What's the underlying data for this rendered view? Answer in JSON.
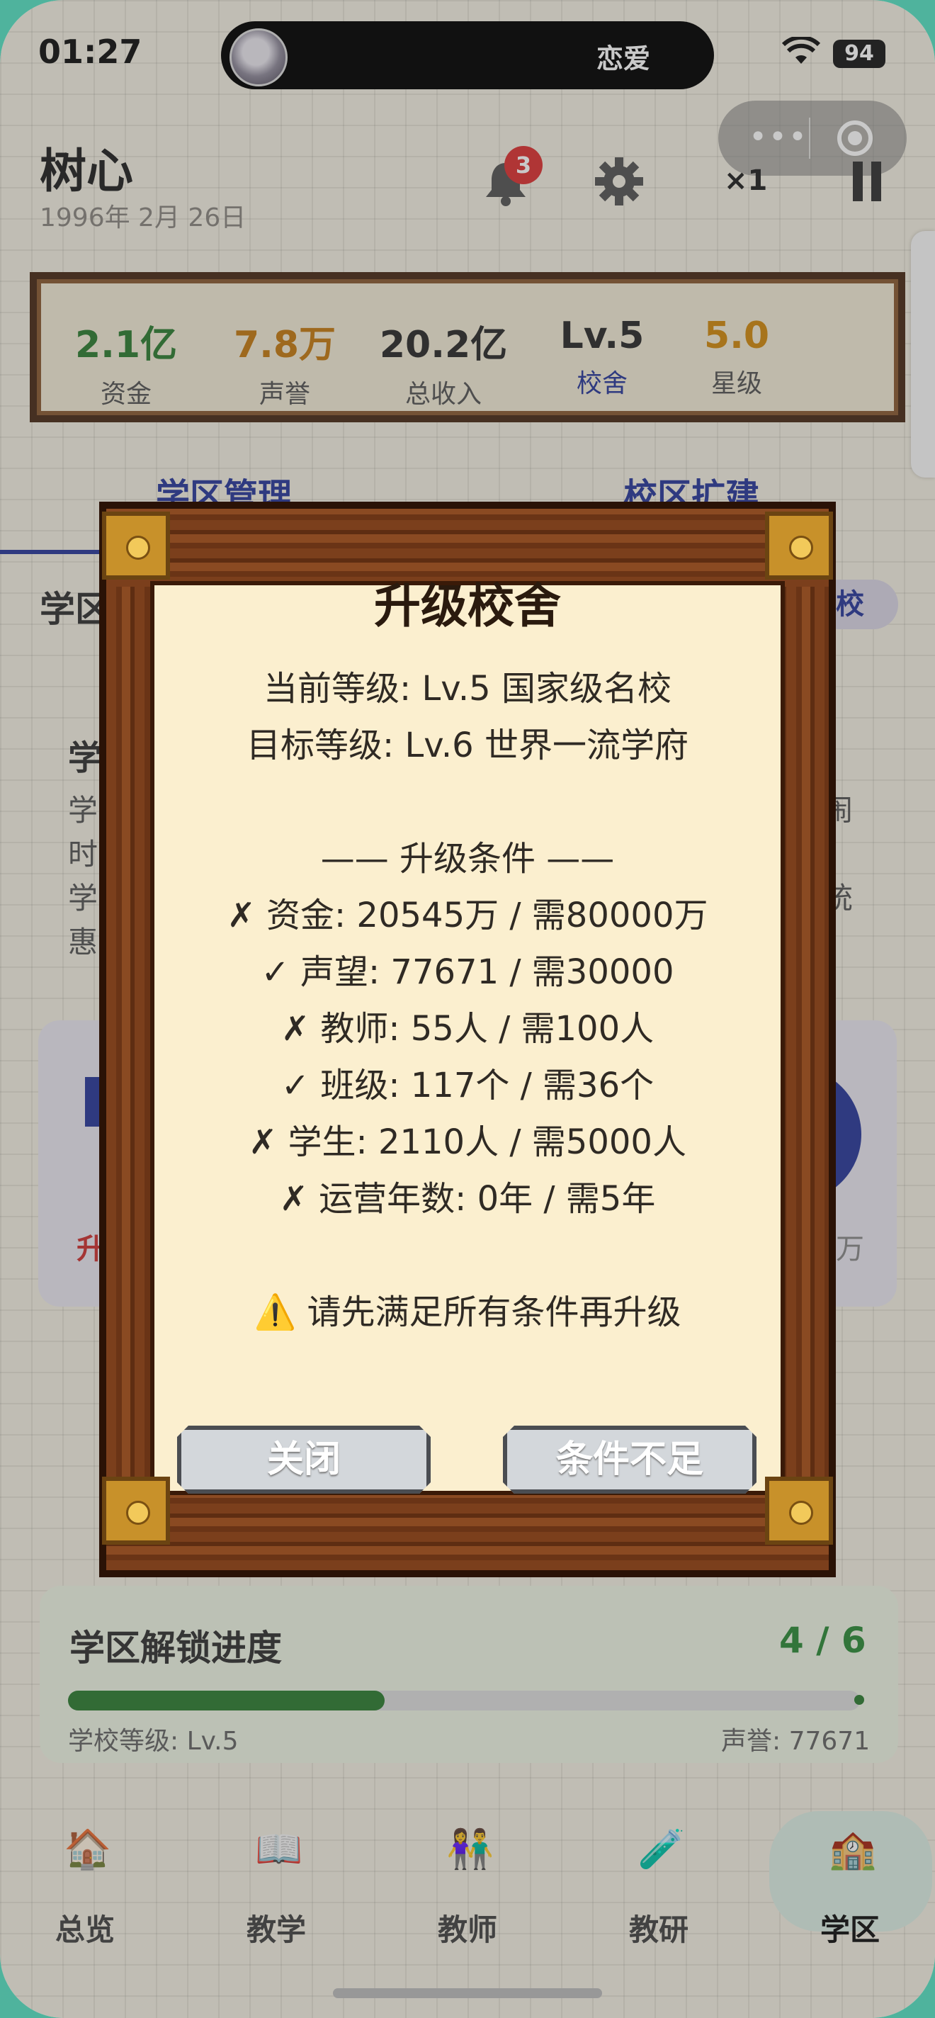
{
  "status_bar": {
    "time": "01:27",
    "island_text": "恋爱",
    "battery": "94"
  },
  "capsule": {
    "more": "•••"
  },
  "header": {
    "name": "树心",
    "date": "1996年 2月 26日",
    "notifications": "3",
    "speed": "×1"
  },
  "stats": [
    {
      "value": "2.1亿",
      "label": "资金",
      "color": "#2e7d32",
      "label_color": "#555555"
    },
    {
      "value": "7.8万",
      "label": "声誉",
      "color": "#c47a12",
      "label_color": "#555555"
    },
    {
      "value": "20.2亿",
      "label": "总收入",
      "color": "#2b2b2b",
      "label_color": "#555555"
    },
    {
      "value": "Lv.5",
      "label": "校舍",
      "color": "#2b2b2b",
      "label_color": "#2a3a9a"
    },
    {
      "value": "5.0",
      "label": "星级",
      "color": "#d08a10",
      "label_color": "#555555"
    }
  ],
  "tabs": {
    "left": "学区管理",
    "right": "校区扩建"
  },
  "background": {
    "section_title": "学区",
    "pill": "校",
    "info_title": "学",
    "lines_left": [
      "学",
      "时",
      "学",
      "惠"
    ],
    "lines_right": [
      "闹",
      "",
      "统",
      ""
    ],
    "card_left": "升",
    "card_right": "万"
  },
  "modal": {
    "title": "升级校舍",
    "current_level": "当前等级: Lv.5 国家级名校",
    "target_level": "目标等级: Lv.6 世界一流学府",
    "conditions_header": "—— 升级条件 ——",
    "conditions": [
      "✗ 资金: 20545万 / 需80000万",
      "✓ 声望: 77671 / 需30000",
      "✗ 教师: 55人 / 需100人",
      "✓ 班级: 117个 / 需36个",
      "✗ 学生: 2110人 / 需5000人",
      "✗ 运营年数: 0年 / 需5年"
    ],
    "warning": "⚠️ 请先满足所有条件再升级",
    "close_button": "关闭",
    "confirm_button": "条件不足"
  },
  "progress": {
    "title": "学区解锁进度",
    "count": "4 / 6",
    "fraction": 0.4,
    "left_label": "学校等级: Lv.5",
    "right_label": "声誉: 77671"
  },
  "nav": [
    {
      "icon": "🏠",
      "label": "总览"
    },
    {
      "icon": "📖",
      "label": "教学"
    },
    {
      "icon": "👫",
      "label": "教师"
    },
    {
      "icon": "🧪",
      "label": "教研"
    },
    {
      "icon": "🏫",
      "label": "学区"
    }
  ]
}
